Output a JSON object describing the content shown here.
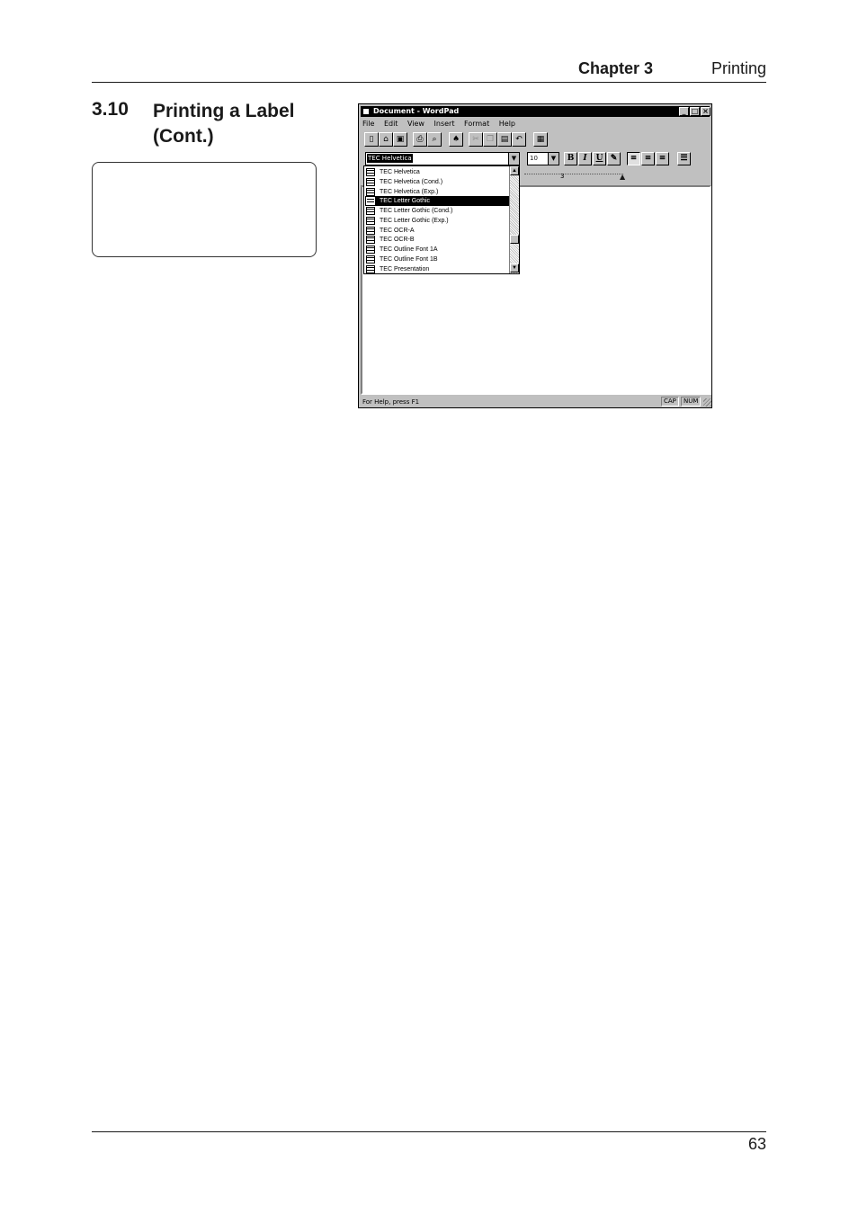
{
  "header": {
    "chapter": "Chapter 3",
    "chapter_title": "Printing"
  },
  "section": {
    "number": "3.10",
    "title": "Printing a Label (Cont.)"
  },
  "footer": {
    "page_number": "63"
  },
  "wordpad": {
    "title": "Document - WordPad",
    "menu": [
      "File",
      "Edit",
      "View",
      "Insert",
      "Format",
      "Help"
    ],
    "font_value": "TEC Helvetica",
    "size_value": "10",
    "format_buttons": [
      "B",
      "I",
      "U"
    ],
    "ruler_mark": "3",
    "font_list": [
      "TEC Helvetica",
      "TEC Helvetica (Cond.)",
      "TEC Helvetica (Exp.)",
      "TEC Letter Gothic",
      "TEC Letter Gothic (Cond.)",
      "TEC Letter Gothic (Exp.)",
      "TEC OCR-A",
      "TEC OCR-B",
      "TEC Outline Font 1A",
      "TEC Outline Font 1B",
      "TEC Presentation"
    ],
    "highlighted_font": "TEC Letter Gothic",
    "status_help": "For Help, press F1",
    "status_cap": "CAP",
    "status_num": "NUM"
  }
}
